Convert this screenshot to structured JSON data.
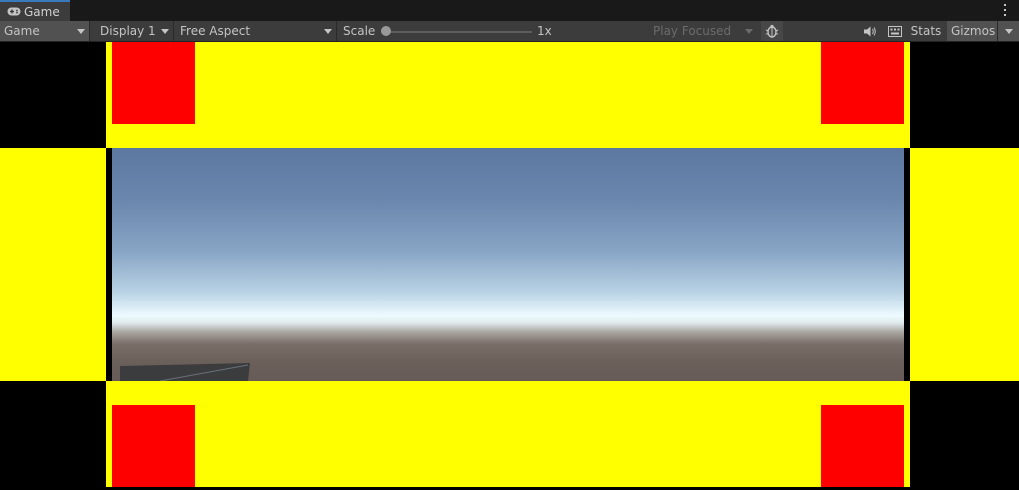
{
  "tab": {
    "label": "Game",
    "icon": "gamepad-icon"
  },
  "toolbar": {
    "view_dropdown": "Game",
    "display_dropdown": "Display 1",
    "aspect_dropdown": "Free Aspect",
    "scale_label": "Scale",
    "scale_value": "1x",
    "play_dropdown": "Play Focused",
    "bug_icon": "bug-icon",
    "audio_icon": "speaker-icon",
    "keyboard_icon": "keyboard-icon",
    "stats_label": "Stats",
    "gizmos_label": "Gizmos",
    "scale_slider_fraction": 0
  },
  "colors": {
    "accent": "#3a79bb",
    "panel": "#3c3c3c",
    "yellow": "#ffff00",
    "red": "#ff0000"
  }
}
